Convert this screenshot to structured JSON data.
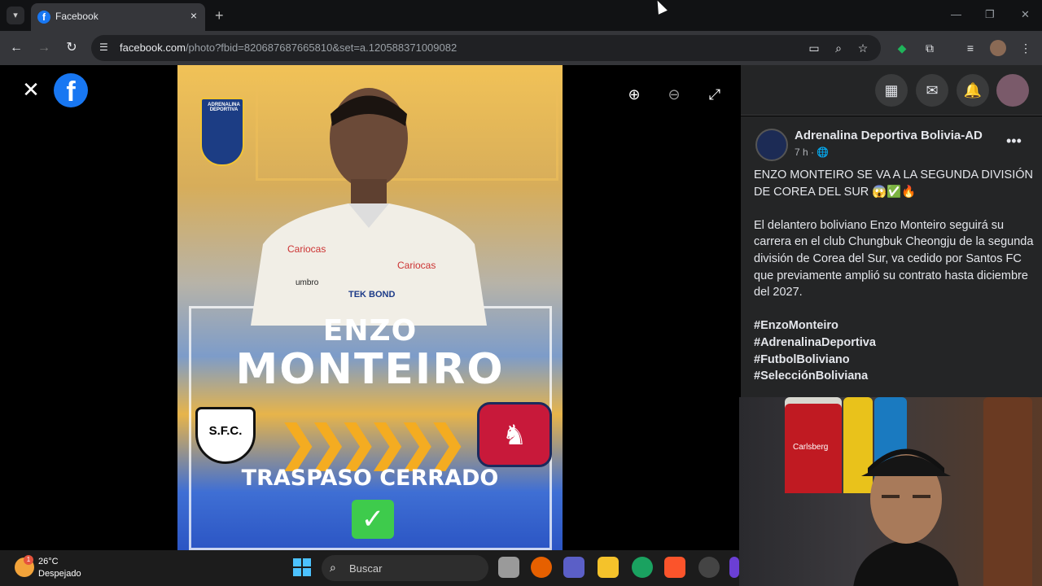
{
  "browser": {
    "tab_title": "Facebook",
    "url_host": "facebook.com",
    "url_path": "/photo?fbid=820687687665810&set=a.120588371009082"
  },
  "poster": {
    "badge_text": "ADRENALINA DEPORTIVA",
    "first_name": "ENZO",
    "last_name": "MONTEIRO",
    "club_from": "S.F.C.",
    "deal_text": "TRASPASO CERRADO",
    "jersey_sponsor1": "Cariocas",
    "jersey_sponsor2": "TEK BOND",
    "jersey_brand": "umbro"
  },
  "post": {
    "page_name": "Adrenalina Deportiva Bolivia-AD",
    "time": "7 h ·",
    "headline": "ENZO MONTEIRO SE VA A LA SEGUNDA DIVISIÓN DE COREA DEL SUR 😱✅🔥",
    "body": "El delantero boliviano Enzo Monteiro seguirá su carrera en el club Chungbuk Cheongju de la segunda división de Corea del Sur, va cedido por Santos FC que previamente amplió su contrato hasta diciembre del 2027.",
    "hashtags": [
      "#EnzoMonteiro",
      "#AdrenalinaDeportiva",
      "#FutbolBoliviano",
      "#SelecciónBoliviana"
    ]
  },
  "taskbar": {
    "weather_badge": "1",
    "temperature": "26°C",
    "condition": "Despejado",
    "search_placeholder": "Buscar"
  },
  "webcam": {
    "jersey_text": "Carlsberg"
  },
  "colors": {
    "fb_blue": "#1877f2",
    "panel_bg": "#242526",
    "browser_bg": "#35363a"
  }
}
